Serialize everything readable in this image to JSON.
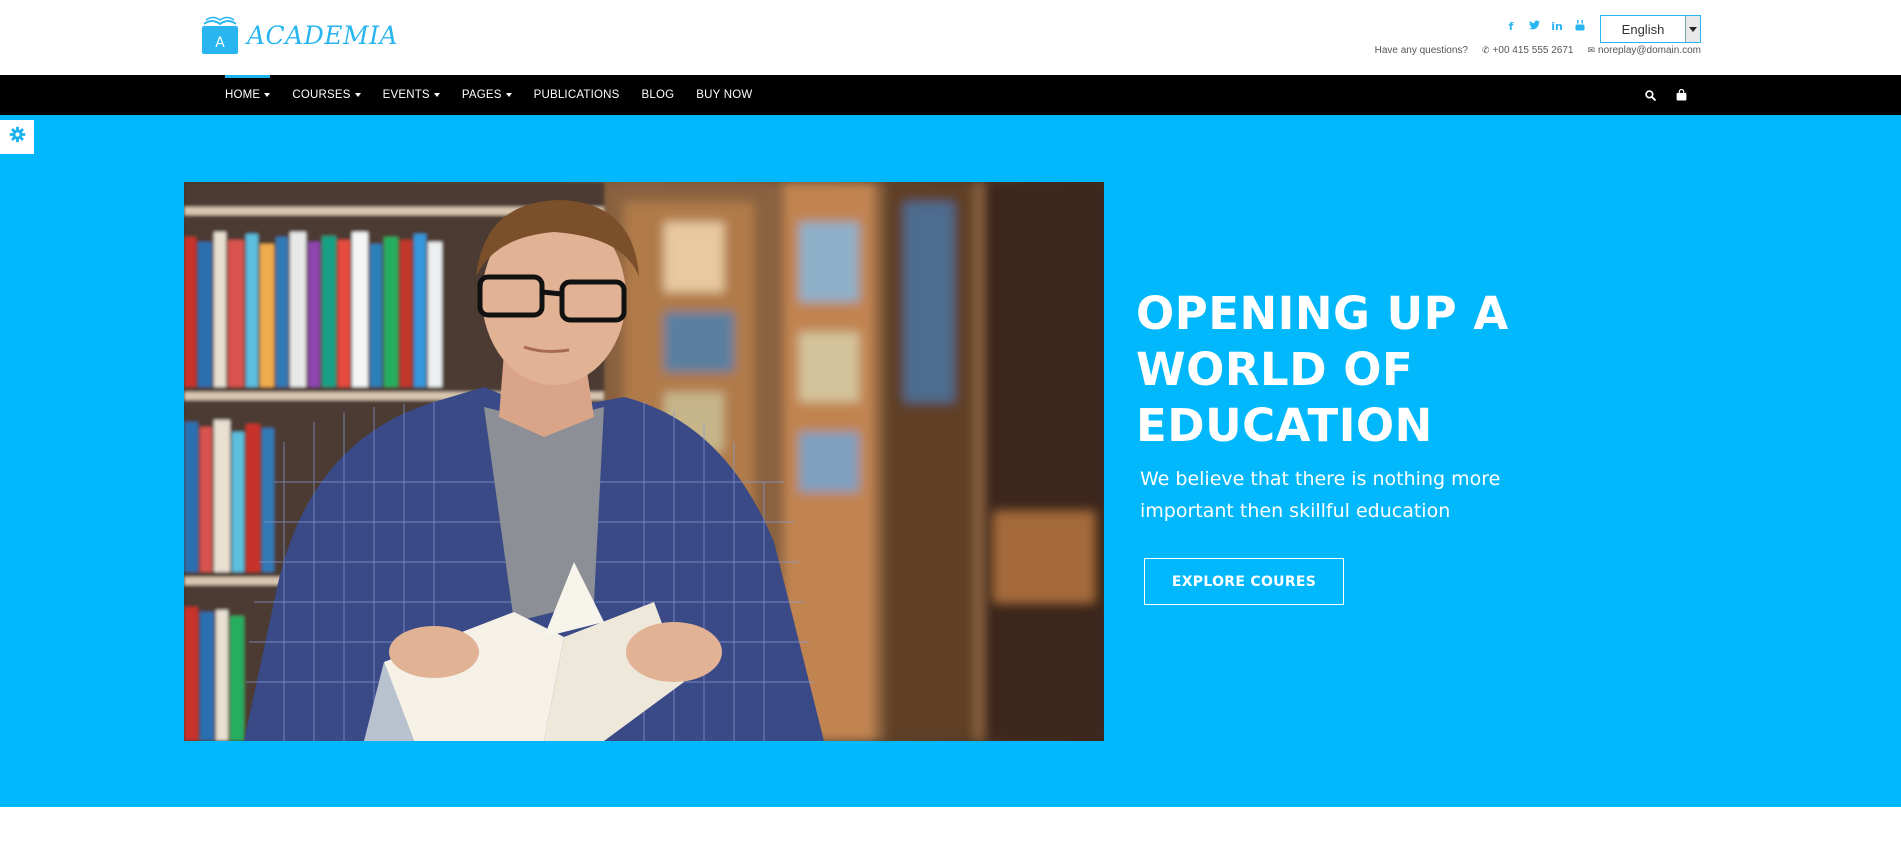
{
  "brand": {
    "name": "ACADEMIA",
    "logo_letter": "A"
  },
  "social": [
    {
      "icon": "facebook-icon",
      "glyph": "f"
    },
    {
      "icon": "twitter-icon",
      "glyph": "t"
    },
    {
      "icon": "linkedin-icon",
      "glyph": "in"
    },
    {
      "icon": "youtube-icon",
      "glyph": "▶"
    }
  ],
  "language": {
    "selected": "English"
  },
  "contact": {
    "question": "Have any questions?",
    "phone": "+00 415 555 2671",
    "email": "noreplay@domain.com"
  },
  "nav": {
    "items": [
      {
        "label": "HOME",
        "dropdown": true,
        "active": true
      },
      {
        "label": "COURSES",
        "dropdown": true
      },
      {
        "label": "EVENTS",
        "dropdown": true
      },
      {
        "label": "PAGES",
        "dropdown": true
      },
      {
        "label": "PUBLICATIONS",
        "dropdown": false
      },
      {
        "label": "BLOG",
        "dropdown": false
      },
      {
        "label": "BUY NOW",
        "dropdown": false
      }
    ],
    "right_icons": [
      "search-icon",
      "shopping-bag-icon"
    ]
  },
  "hero": {
    "title_lines": [
      "OPENING UP A",
      "WORLD OF",
      "EDUCATION"
    ],
    "subtitle_lines": [
      "We believe that there is nothing more",
      "important then skillful education"
    ],
    "button_label": "EXPLORE COURES"
  },
  "colors": {
    "accent": "#29b6f0",
    "hero_bg": "#00b8fb",
    "nav_bg": "#000000"
  }
}
